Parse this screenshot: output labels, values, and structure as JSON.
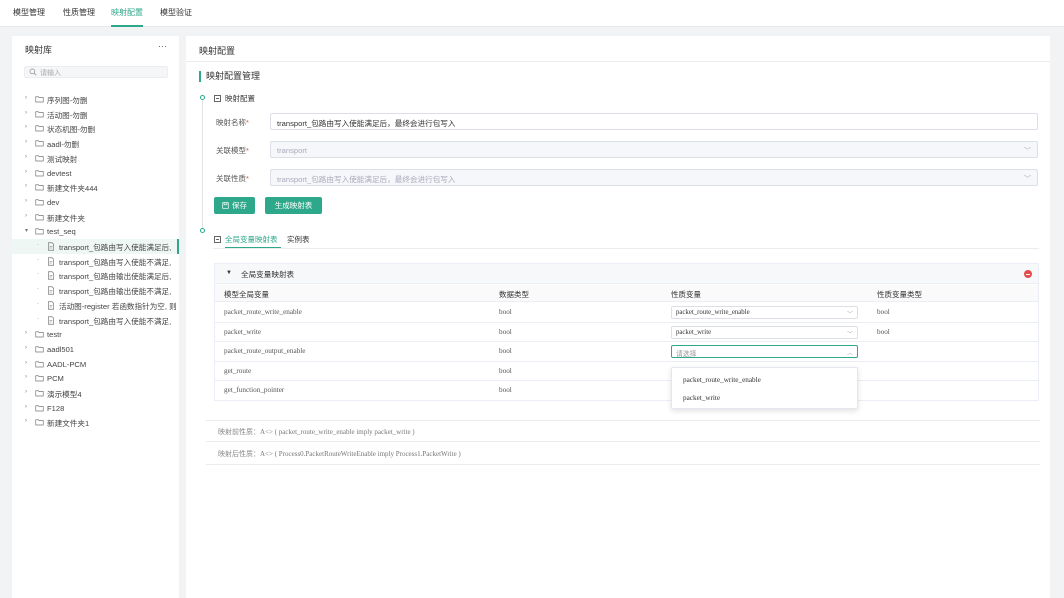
{
  "top_tabs": [
    {
      "label": "模型管理",
      "active": false
    },
    {
      "label": "性质管理",
      "active": false
    },
    {
      "label": "映射配置",
      "active": true
    },
    {
      "label": "模型验证",
      "active": false
    }
  ],
  "sidebar": {
    "title": "映射库",
    "more": "···",
    "search_placeholder": "请输入",
    "tree": [
      {
        "label": "序列图-勿删",
        "type": "folder",
        "level": 0,
        "expanded": false
      },
      {
        "label": "活动图-勿删",
        "type": "folder",
        "level": 0,
        "expanded": false
      },
      {
        "label": "状态机图-勿删",
        "type": "folder",
        "level": 0,
        "expanded": false
      },
      {
        "label": "aadl-勿删",
        "type": "folder",
        "level": 0,
        "expanded": false
      },
      {
        "label": "测试映射",
        "type": "folder",
        "level": 0,
        "expanded": false
      },
      {
        "label": "devtest",
        "type": "folder",
        "level": 0,
        "expanded": false
      },
      {
        "label": "新建文件夹444",
        "type": "folder",
        "level": 0,
        "expanded": false
      },
      {
        "label": "dev",
        "type": "folder",
        "level": 0,
        "expanded": false
      },
      {
        "label": "新建文件夹",
        "type": "folder",
        "level": 0,
        "expanded": false
      },
      {
        "label": "test_seq",
        "type": "folder",
        "level": 0,
        "expanded": true
      },
      {
        "label": "transport_包路由写入使能满足后,",
        "type": "file",
        "level": 1,
        "selected": true
      },
      {
        "label": "transport_包路由写入使能不满足,",
        "type": "file",
        "level": 1
      },
      {
        "label": "transport_包路由输出使能满足后,",
        "type": "file",
        "level": 1
      },
      {
        "label": "transport_包路由输出使能不满足,",
        "type": "file",
        "level": 1
      },
      {
        "label": "活动图-register 若函数指针为空, 则",
        "type": "file",
        "level": 1
      },
      {
        "label": "transport_包路由写入使能不满足,",
        "type": "file",
        "level": 1
      },
      {
        "label": "testr",
        "type": "folder",
        "level": 0,
        "expanded": false
      },
      {
        "label": "aadl501",
        "type": "folder",
        "level": 0,
        "expanded": false
      },
      {
        "label": "AADL-PCM",
        "type": "folder",
        "level": 0,
        "expanded": false
      },
      {
        "label": "PCM",
        "type": "folder",
        "level": 0,
        "expanded": false
      },
      {
        "label": "演示模型4",
        "type": "folder",
        "level": 0,
        "expanded": false
      },
      {
        "label": "F128",
        "type": "folder",
        "level": 0,
        "expanded": false
      },
      {
        "label": "新建文件夹1",
        "type": "folder",
        "level": 0,
        "expanded": false
      }
    ]
  },
  "main": {
    "title": "映射配置",
    "section_title": "映射配置管理",
    "config_collapse_label": "映射配置",
    "form": {
      "name_label": "映射名称",
      "name_value": "transport_包路由写入使能满足后，最终会进行包写入",
      "model_label": "关联模型",
      "model_value": "transport",
      "property_label": "关联性质",
      "property_value": "transport_包路由写入使能满足后，最终会进行包写入",
      "required_mark": "*"
    },
    "buttons": {
      "save": "保存",
      "generate": "生成映射表"
    },
    "tabs": {
      "global": "全局变量映射表",
      "instance": "实例表"
    },
    "table": {
      "group_title": "全局变量映射表",
      "columns": [
        "模型全局变量",
        "数据类型",
        "性质变量",
        "性质变量类型"
      ],
      "rows": [
        {
          "var": "packet_route_write_enable",
          "type": "bool",
          "prop": "packet_route_write_enable",
          "prop_type": "bool",
          "has_select": true
        },
        {
          "var": "packet_write",
          "type": "bool",
          "prop": "packet_write",
          "prop_type": "bool",
          "has_select": true
        },
        {
          "var": "packet_route_output_enable",
          "type": "bool",
          "prop": "",
          "prop_type": "",
          "has_select": true,
          "focused": true,
          "placeholder": "请选择"
        },
        {
          "var": "get_route",
          "type": "bool",
          "prop": "",
          "prop_type": "",
          "has_select": false
        },
        {
          "var": "get_function_pointer",
          "type": "bool",
          "prop": "",
          "prop_type": "",
          "has_select": false
        }
      ]
    },
    "dropdown_options": [
      "packet_route_write_enable",
      "packet_write"
    ],
    "notes": {
      "before_label": "映射前性质：",
      "before_value": "A<> ( packet_route_write_enable imply packet_write )",
      "after_label": "映射后性质：",
      "after_value": "A<> ( Process0.PacketRouteWriteEnable imply Process1.PacketWrite )"
    }
  },
  "colors": {
    "accent": "#2ea88a",
    "danger": "#e34d4d"
  }
}
